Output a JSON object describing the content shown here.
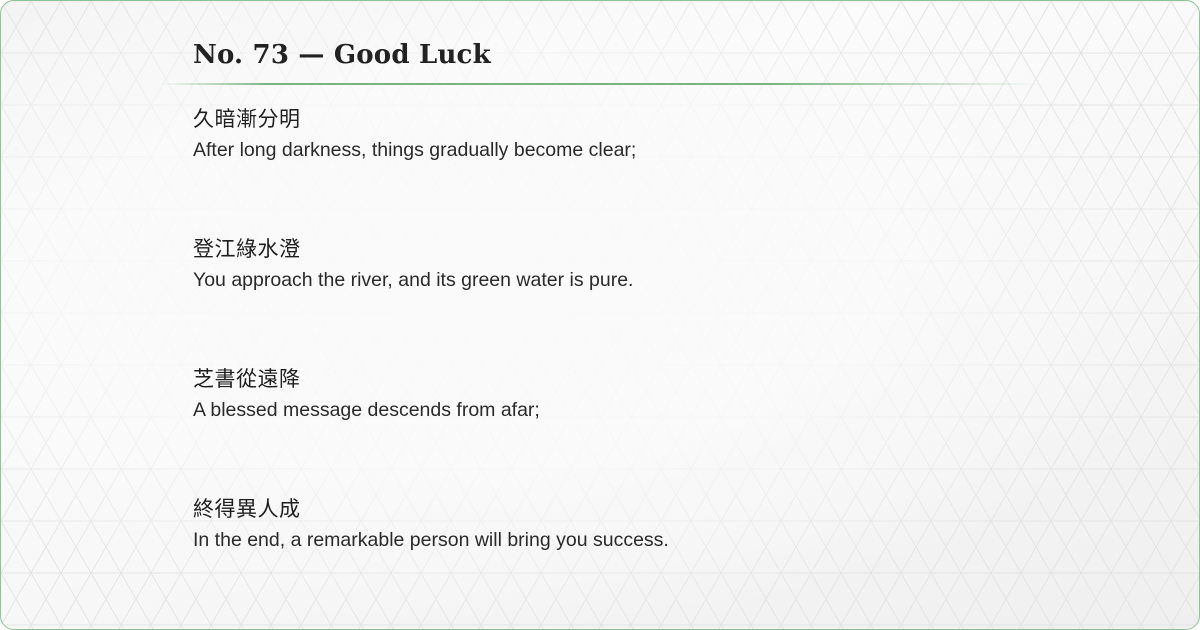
{
  "card": {
    "title": "No. 73 — Good Luck",
    "accent_color": "#7db582",
    "verses": [
      {
        "chinese": "久暗漸分明",
        "english": "After long darkness, things gradually become clear;"
      },
      {
        "chinese": "登江綠水澄",
        "english": "You approach the river, and its green water is pure."
      },
      {
        "chinese": "芝書從遠降",
        "english": "A blessed message descends from afar;"
      },
      {
        "chinese": "終得異人成",
        "english": "In the end, a remarkable person will bring you success."
      }
    ]
  }
}
